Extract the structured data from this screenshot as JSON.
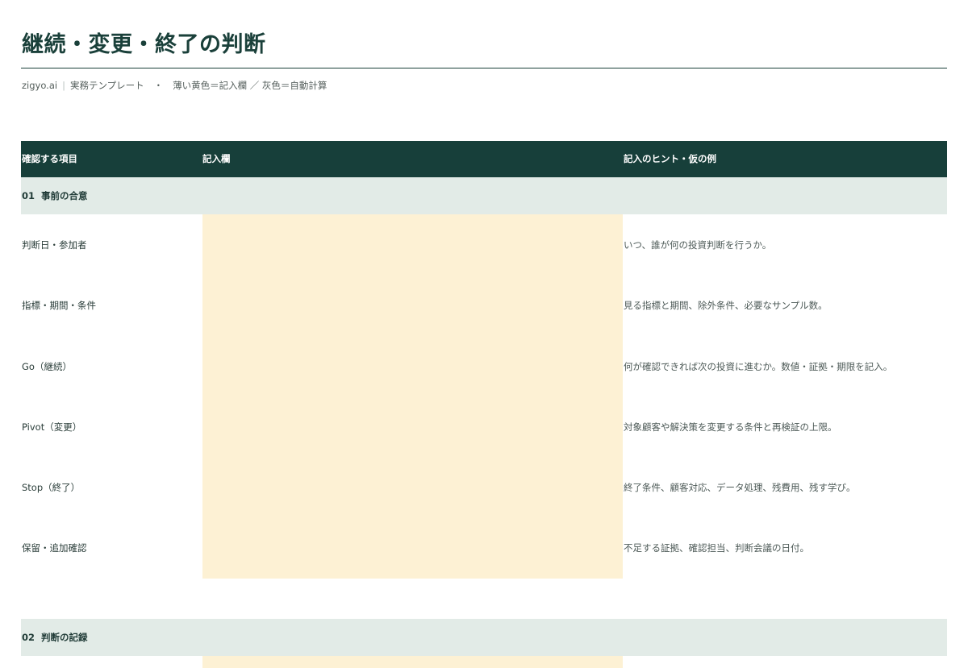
{
  "title": "継続・変更・終了の判断",
  "subtitle": {
    "brand": "zigyo.ai",
    "separator": "|",
    "label": "実務テンプレート",
    "dot": "・",
    "legend": "薄い黄色＝記入欄 ／ 灰色＝自動計算"
  },
  "table": {
    "headers": [
      "確認する項目",
      "記入欄",
      "記入のヒント・仮の例"
    ],
    "sections": [
      {
        "number": "01",
        "title": "事前の合意",
        "rows": [
          {
            "item": "判断日・参加者",
            "value": "",
            "hint": "いつ、誰が何の投資判断を行うか。"
          },
          {
            "item": "指標・期間・条件",
            "value": "",
            "hint": "見る指標と期間、除外条件、必要なサンプル数。"
          },
          {
            "item": "Go（継続）",
            "value": "",
            "hint": "何が確認できれば次の投資に進むか。数値・証拠・期限を記入。"
          },
          {
            "item": "Pivot（変更）",
            "value": "",
            "hint": "対象顧客や解決策を変更する条件と再検証の上限。"
          },
          {
            "item": "Stop（終了）",
            "value": "",
            "hint": "終了条件、顧客対応、データ処理、残費用、残す学び。"
          },
          {
            "item": "保留・追加確認",
            "value": "",
            "hint": "不足する証拠、確認担当、判断会議の日付。"
          }
        ]
      },
      {
        "number": "02",
        "title": "判断の記録",
        "rows": []
      }
    ]
  },
  "colors": {
    "header_bg": "#173f3a",
    "section_bg": "#e2ebe7",
    "input_bg": "#fdf1d4",
    "title": "#1a403a"
  }
}
